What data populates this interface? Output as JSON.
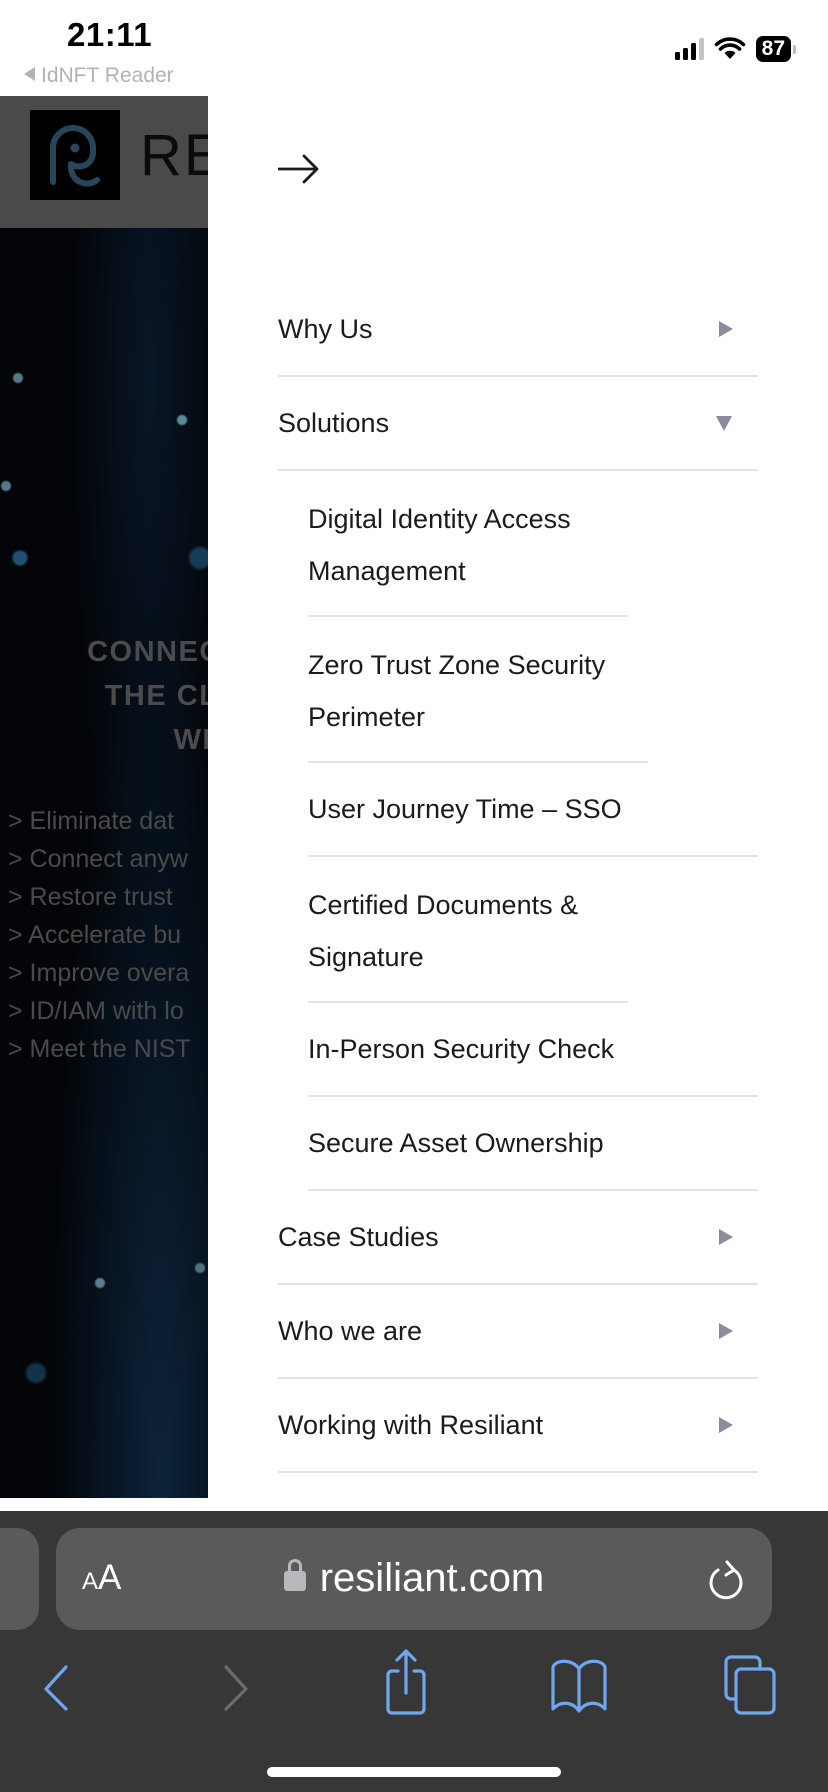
{
  "status_bar": {
    "time": "21:11",
    "back_app": "IdNFT Reader",
    "battery": "87"
  },
  "background_page": {
    "brand_partial": "RE",
    "hero_title_lines": [
      "CONNECTIN",
      "THE CLI",
      "WI"
    ],
    "hero_list": [
      "> Eliminate dat",
      "> Connect anyw",
      "> Restore trust",
      "> Accelerate bu",
      "> Improve overa",
      "> ID/IAM with lo",
      "> Meet the NIST"
    ]
  },
  "drawer": {
    "close_icon": "arrow-right-icon",
    "menu": [
      {
        "label": "Why Us",
        "state": "collapsed"
      },
      {
        "label": "Solutions",
        "state": "expanded"
      },
      {
        "label": "Case Studies",
        "state": "collapsed"
      },
      {
        "label": "Who we are",
        "state": "collapsed"
      },
      {
        "label": "Working with Resiliant",
        "state": "collapsed"
      }
    ],
    "solutions_submenu": [
      "Digital Identity Access Management",
      "Zero Trust Zone Security Perimeter",
      "User Journey Time – SSO",
      "Certified Documents & Signature",
      "In-Person Security Check",
      "Secure Asset Ownership"
    ],
    "arrow_color": "#8a8c9c"
  },
  "safari": {
    "aa_small": "A",
    "aa_big": "A",
    "url": "resiliant.com",
    "accent_color": "#6fa6f0",
    "disabled_color": "#6b6b6b"
  }
}
